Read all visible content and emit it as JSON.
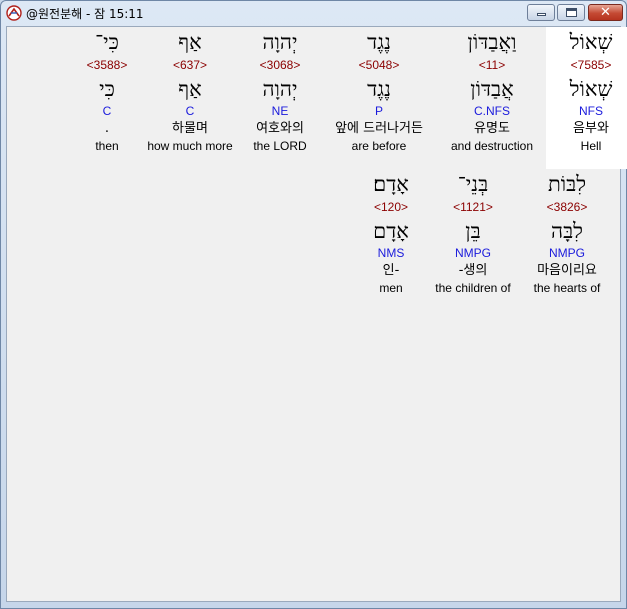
{
  "window": {
    "title": "@원전분해 - 잠 15:11",
    "minimize_glyph": "",
    "maximize_glyph": "",
    "close_glyph": "✕",
    "icon": "app-logo-icon"
  },
  "words": [
    {
      "hebrew": "שְׁאוֹל",
      "strong": "<7585>",
      "lemma": "שְׁאוֹל",
      "morph": "NFS",
      "korean": "음부와",
      "english": "Hell",
      "highlighted": true
    },
    {
      "hebrew": "וַאֲבַדּוֹן",
      "strong": "<11>",
      "lemma": "אֲבַדּוֹן",
      "morph": "C.NFS",
      "korean": "유명도",
      "english": "and destruction",
      "highlighted": false
    },
    {
      "hebrew": "נֶגֶד",
      "strong": "<5048>",
      "lemma": "נֶגֶד",
      "morph": "P",
      "korean": "앞에 드러나거든",
      "english": "are before",
      "highlighted": false
    },
    {
      "hebrew": "יְהוָה",
      "strong": "<3068>",
      "lemma": "יְהוָה",
      "morph": "NE",
      "korean": "여호와의",
      "english": "the LORD",
      "highlighted": false
    },
    {
      "hebrew": "אַף",
      "strong": "<637>",
      "lemma": "אַף",
      "morph": "C",
      "korean": "하물며",
      "english": "how much more",
      "highlighted": false
    },
    {
      "hebrew": "כִּי־",
      "strong": "<3588>",
      "lemma": "כִּי",
      "morph": "C",
      "korean": ".",
      "english": "then",
      "highlighted": false
    },
    {
      "hebrew": "לִבּוֹת",
      "strong": "<3826>",
      "lemma": "לִבָּה",
      "morph": "NMPG",
      "korean": "마음이리요",
      "english": "the hearts of",
      "highlighted": false
    },
    {
      "hebrew": "בְּנֵי־",
      "strong": "<1121>",
      "lemma": "בֵּן",
      "morph": "NMPG",
      "korean": "-생의",
      "english": "the children of",
      "highlighted": false
    },
    {
      "hebrew": "אָדָם׃",
      "strong": "<120>",
      "lemma": "אָדָם",
      "morph": "NMS",
      "korean": "인-",
      "english": "men",
      "highlighted": false
    }
  ]
}
